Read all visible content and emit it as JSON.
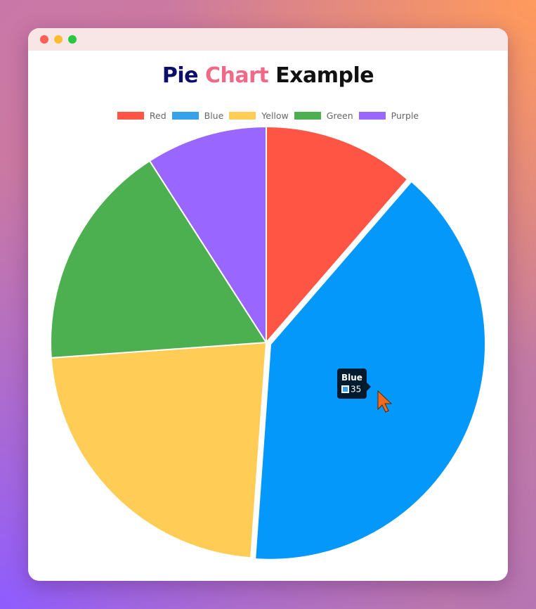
{
  "window": {
    "title_parts": [
      "Pie",
      "Chart",
      "Example"
    ]
  },
  "colors": {
    "window_dot_close": "#ff5f57",
    "window_dot_minimize": "#febc2e",
    "window_dot_maximize": "#28c840",
    "title_pie": "#0d0d6b",
    "title_chart": "#f06a87",
    "title_example": "#111111"
  },
  "tooltip": {
    "title": "Blue",
    "value": "35",
    "color": "#36a2eb"
  },
  "chart_data": {
    "type": "pie",
    "title": "Pie Chart Example",
    "legend_position": "top",
    "categories": [
      "Red",
      "Blue",
      "Yellow",
      "Green",
      "Purple"
    ],
    "values": [
      10,
      35,
      20,
      15,
      8
    ],
    "colors": [
      "#ff5544",
      "#0598fb",
      "#ffcc55",
      "#4caf50",
      "#9966ff"
    ],
    "legend_colors": [
      "#ff5544",
      "#36a2eb",
      "#ffcd56",
      "#4caf50",
      "#9966ff"
    ],
    "hovered": "Blue"
  }
}
